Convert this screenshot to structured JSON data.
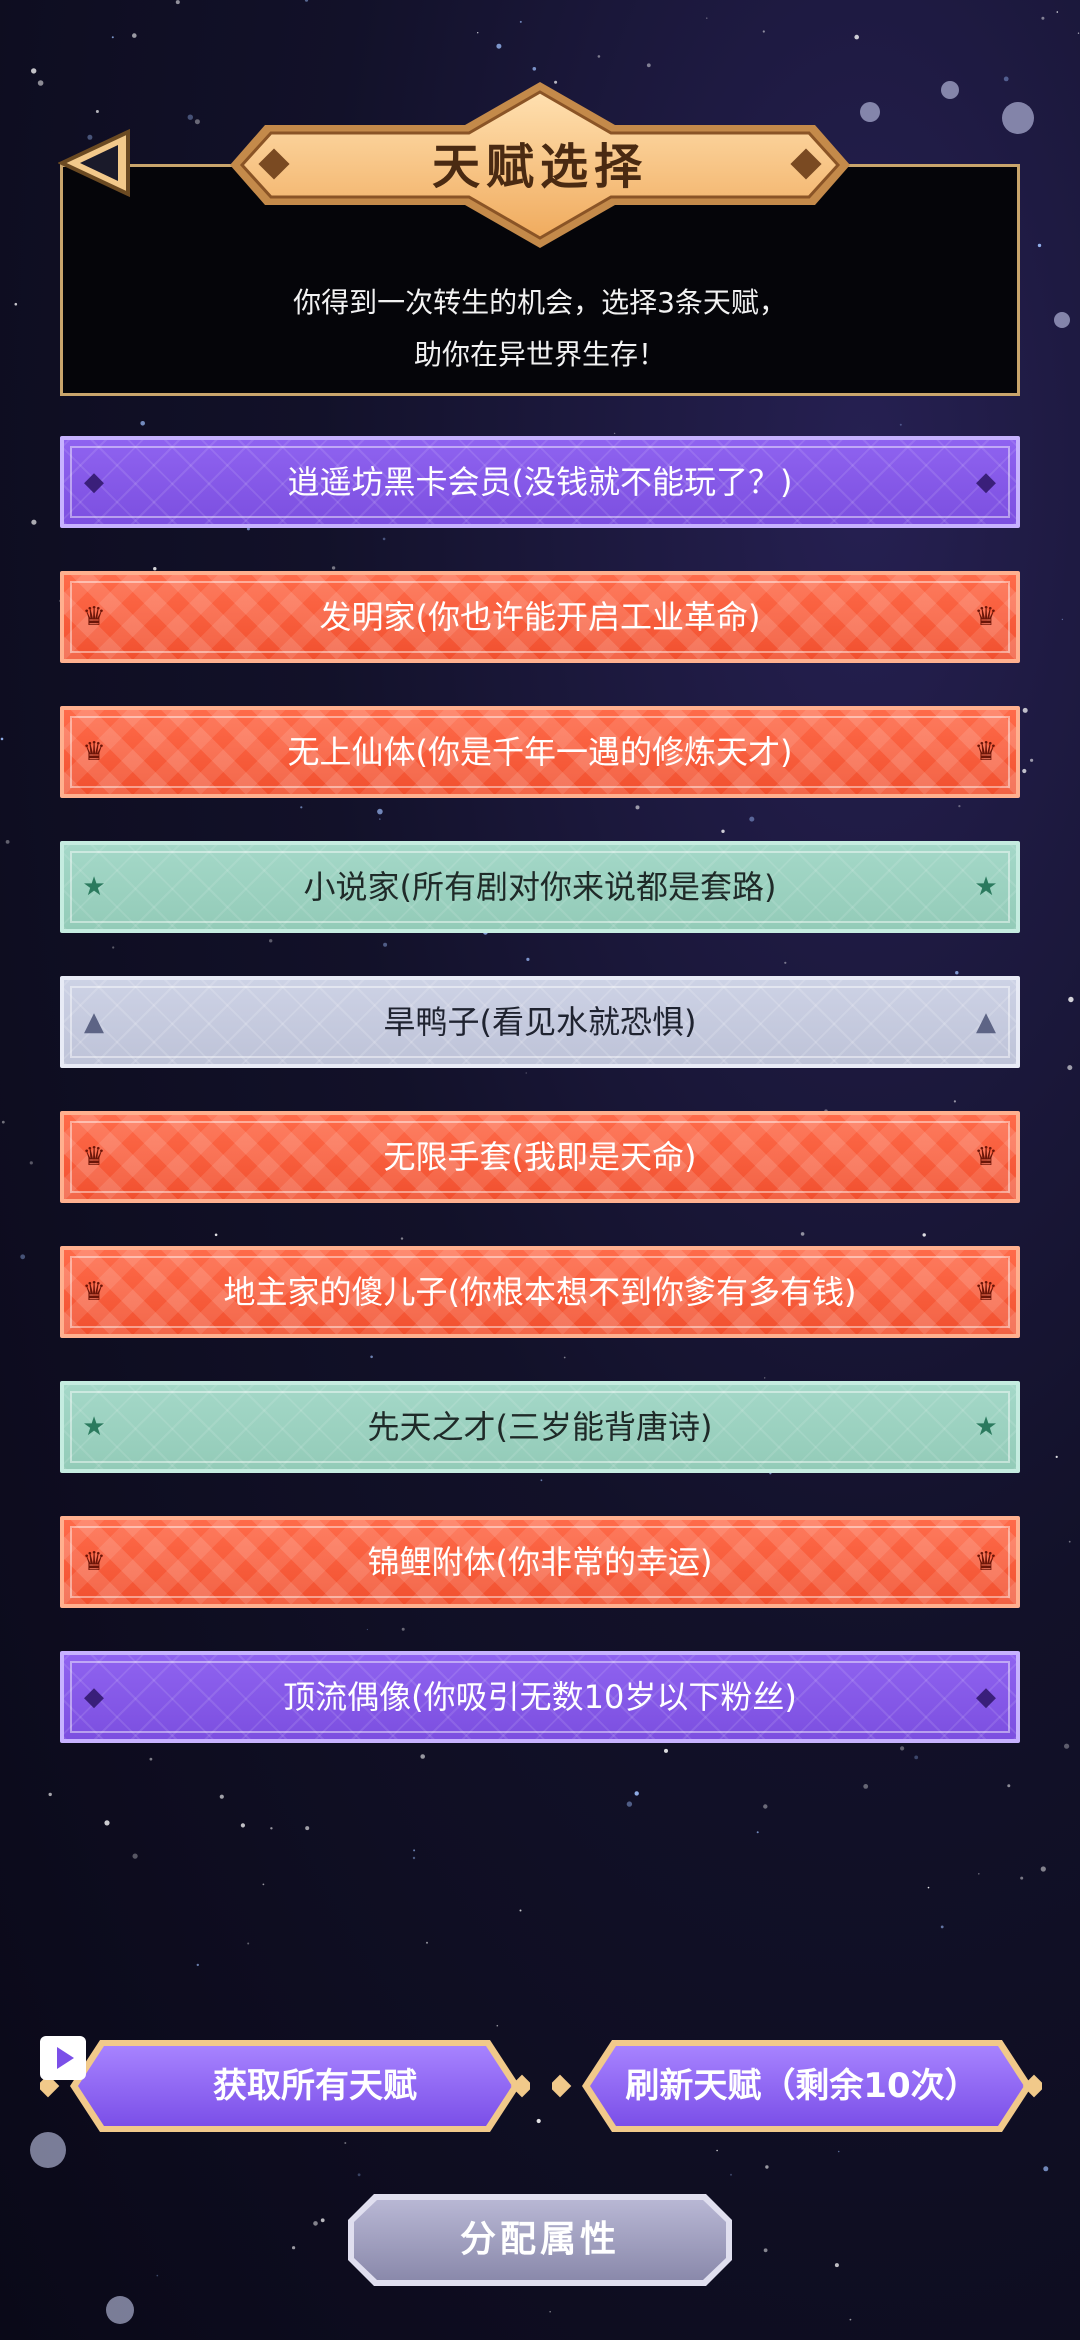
{
  "header": {
    "title": "天赋选择",
    "subtitle": "你得到一次转生的机会，选择3条天赋，\n助你在异世界生存！",
    "back_icon": "back-arrow-icon"
  },
  "talents": [
    {
      "label": "逍遥坊黑卡会员(没钱就不能玩了？)",
      "tier": "purple",
      "icon": "diamond-icon",
      "glyph": "◆"
    },
    {
      "label": "发明家(你也许能开启工业革命)",
      "tier": "orange",
      "icon": "crown-icon",
      "glyph": "♛"
    },
    {
      "label": "无上仙体(你是千年一遇的修炼天才)",
      "tier": "orange",
      "icon": "crown-icon",
      "glyph": "♛"
    },
    {
      "label": "小说家(所有剧对你来说都是套路)",
      "tier": "teal",
      "icon": "star-icon",
      "glyph": "★"
    },
    {
      "label": "旱鸭子(看见水就恐惧)",
      "tier": "gray",
      "icon": "triangle-icon",
      "glyph": "▲"
    },
    {
      "label": "无限手套(我即是天命)",
      "tier": "orange",
      "icon": "crown-icon",
      "glyph": "♛"
    },
    {
      "label": "地主家的傻儿子(你根本想不到你爹有多有钱)",
      "tier": "orange",
      "icon": "crown-icon",
      "glyph": "♛"
    },
    {
      "label": "先天之才(三岁能背唐诗)",
      "tier": "teal",
      "icon": "star-icon",
      "glyph": "★"
    },
    {
      "label": "锦鲤附体(你非常的幸运)",
      "tier": "orange",
      "icon": "crown-icon",
      "glyph": "♛"
    },
    {
      "label": "顶流偶像(你吸引无数10岁以下粉丝)",
      "tier": "purple",
      "icon": "diamond-icon",
      "glyph": "◆"
    }
  ],
  "buttons": {
    "get_all": "获取所有天赋",
    "refresh": "刷新天赋（剩余10次）",
    "allocate": "分配属性",
    "video_icon": "play-video-icon"
  },
  "colors": {
    "purple": "#8b5cf0",
    "orange": "#f35a38",
    "teal": "#9cd3c2",
    "gray": "#c7cce0",
    "gold": "#f5c27a",
    "background": "#131129"
  }
}
